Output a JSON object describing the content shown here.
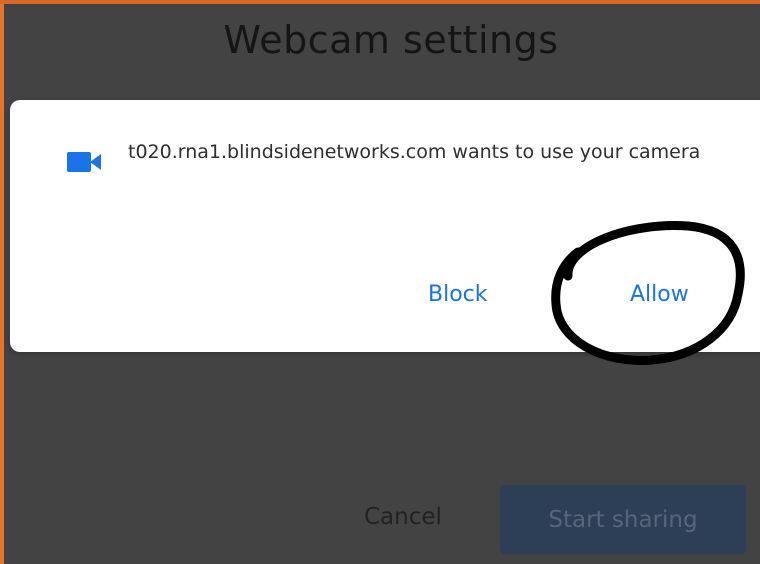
{
  "modal": {
    "title": "Webcam settings",
    "cancel_label": "Cancel",
    "start_label": "Start sharing"
  },
  "permission": {
    "message": "t020.rna1.blindsidenetworks.com wants to use your camera",
    "block_label": "Block",
    "allow_label": "Allow",
    "icon": "video-camera-icon"
  },
  "colors": {
    "accent": "#1a73e8",
    "overlay": "#434343",
    "start_button_bg": "#2c3f56",
    "annotation": "#000000",
    "left_edge": "#e8742a"
  }
}
